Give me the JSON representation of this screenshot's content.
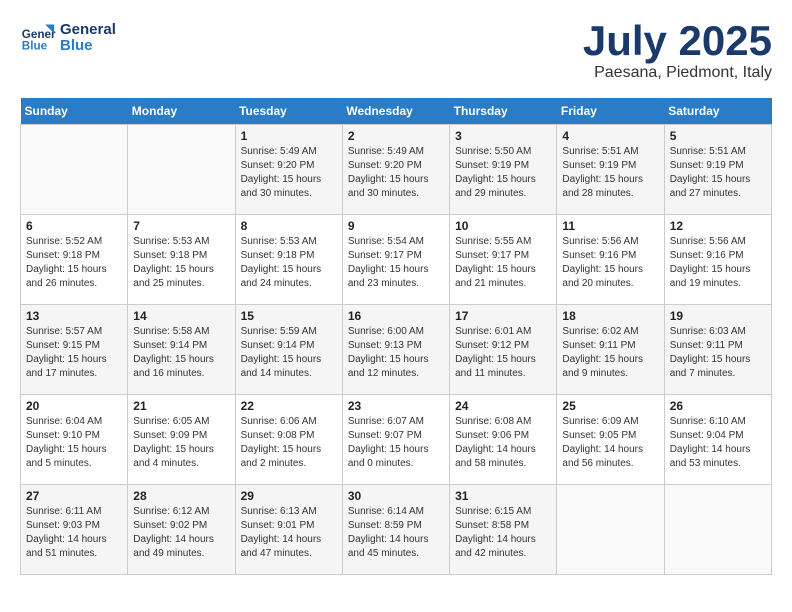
{
  "header": {
    "logo_line1": "General",
    "logo_line2": "Blue",
    "month": "July 2025",
    "location": "Paesana, Piedmont, Italy"
  },
  "weekdays": [
    "Sunday",
    "Monday",
    "Tuesday",
    "Wednesday",
    "Thursday",
    "Friday",
    "Saturday"
  ],
  "weeks": [
    [
      {
        "day": "",
        "info": ""
      },
      {
        "day": "",
        "info": ""
      },
      {
        "day": "1",
        "info": "Sunrise: 5:49 AM\nSunset: 9:20 PM\nDaylight: 15 hours\nand 30 minutes."
      },
      {
        "day": "2",
        "info": "Sunrise: 5:49 AM\nSunset: 9:20 PM\nDaylight: 15 hours\nand 30 minutes."
      },
      {
        "day": "3",
        "info": "Sunrise: 5:50 AM\nSunset: 9:19 PM\nDaylight: 15 hours\nand 29 minutes."
      },
      {
        "day": "4",
        "info": "Sunrise: 5:51 AM\nSunset: 9:19 PM\nDaylight: 15 hours\nand 28 minutes."
      },
      {
        "day": "5",
        "info": "Sunrise: 5:51 AM\nSunset: 9:19 PM\nDaylight: 15 hours\nand 27 minutes."
      }
    ],
    [
      {
        "day": "6",
        "info": "Sunrise: 5:52 AM\nSunset: 9:18 PM\nDaylight: 15 hours\nand 26 minutes."
      },
      {
        "day": "7",
        "info": "Sunrise: 5:53 AM\nSunset: 9:18 PM\nDaylight: 15 hours\nand 25 minutes."
      },
      {
        "day": "8",
        "info": "Sunrise: 5:53 AM\nSunset: 9:18 PM\nDaylight: 15 hours\nand 24 minutes."
      },
      {
        "day": "9",
        "info": "Sunrise: 5:54 AM\nSunset: 9:17 PM\nDaylight: 15 hours\nand 23 minutes."
      },
      {
        "day": "10",
        "info": "Sunrise: 5:55 AM\nSunset: 9:17 PM\nDaylight: 15 hours\nand 21 minutes."
      },
      {
        "day": "11",
        "info": "Sunrise: 5:56 AM\nSunset: 9:16 PM\nDaylight: 15 hours\nand 20 minutes."
      },
      {
        "day": "12",
        "info": "Sunrise: 5:56 AM\nSunset: 9:16 PM\nDaylight: 15 hours\nand 19 minutes."
      }
    ],
    [
      {
        "day": "13",
        "info": "Sunrise: 5:57 AM\nSunset: 9:15 PM\nDaylight: 15 hours\nand 17 minutes."
      },
      {
        "day": "14",
        "info": "Sunrise: 5:58 AM\nSunset: 9:14 PM\nDaylight: 15 hours\nand 16 minutes."
      },
      {
        "day": "15",
        "info": "Sunrise: 5:59 AM\nSunset: 9:14 PM\nDaylight: 15 hours\nand 14 minutes."
      },
      {
        "day": "16",
        "info": "Sunrise: 6:00 AM\nSunset: 9:13 PM\nDaylight: 15 hours\nand 12 minutes."
      },
      {
        "day": "17",
        "info": "Sunrise: 6:01 AM\nSunset: 9:12 PM\nDaylight: 15 hours\nand 11 minutes."
      },
      {
        "day": "18",
        "info": "Sunrise: 6:02 AM\nSunset: 9:11 PM\nDaylight: 15 hours\nand 9 minutes."
      },
      {
        "day": "19",
        "info": "Sunrise: 6:03 AM\nSunset: 9:11 PM\nDaylight: 15 hours\nand 7 minutes."
      }
    ],
    [
      {
        "day": "20",
        "info": "Sunrise: 6:04 AM\nSunset: 9:10 PM\nDaylight: 15 hours\nand 5 minutes."
      },
      {
        "day": "21",
        "info": "Sunrise: 6:05 AM\nSunset: 9:09 PM\nDaylight: 15 hours\nand 4 minutes."
      },
      {
        "day": "22",
        "info": "Sunrise: 6:06 AM\nSunset: 9:08 PM\nDaylight: 15 hours\nand 2 minutes."
      },
      {
        "day": "23",
        "info": "Sunrise: 6:07 AM\nSunset: 9:07 PM\nDaylight: 15 hours\nand 0 minutes."
      },
      {
        "day": "24",
        "info": "Sunrise: 6:08 AM\nSunset: 9:06 PM\nDaylight: 14 hours\nand 58 minutes."
      },
      {
        "day": "25",
        "info": "Sunrise: 6:09 AM\nSunset: 9:05 PM\nDaylight: 14 hours\nand 56 minutes."
      },
      {
        "day": "26",
        "info": "Sunrise: 6:10 AM\nSunset: 9:04 PM\nDaylight: 14 hours\nand 53 minutes."
      }
    ],
    [
      {
        "day": "27",
        "info": "Sunrise: 6:11 AM\nSunset: 9:03 PM\nDaylight: 14 hours\nand 51 minutes."
      },
      {
        "day": "28",
        "info": "Sunrise: 6:12 AM\nSunset: 9:02 PM\nDaylight: 14 hours\nand 49 minutes."
      },
      {
        "day": "29",
        "info": "Sunrise: 6:13 AM\nSunset: 9:01 PM\nDaylight: 14 hours\nand 47 minutes."
      },
      {
        "day": "30",
        "info": "Sunrise: 6:14 AM\nSunset: 8:59 PM\nDaylight: 14 hours\nand 45 minutes."
      },
      {
        "day": "31",
        "info": "Sunrise: 6:15 AM\nSunset: 8:58 PM\nDaylight: 14 hours\nand 42 minutes."
      },
      {
        "day": "",
        "info": ""
      },
      {
        "day": "",
        "info": ""
      }
    ]
  ]
}
